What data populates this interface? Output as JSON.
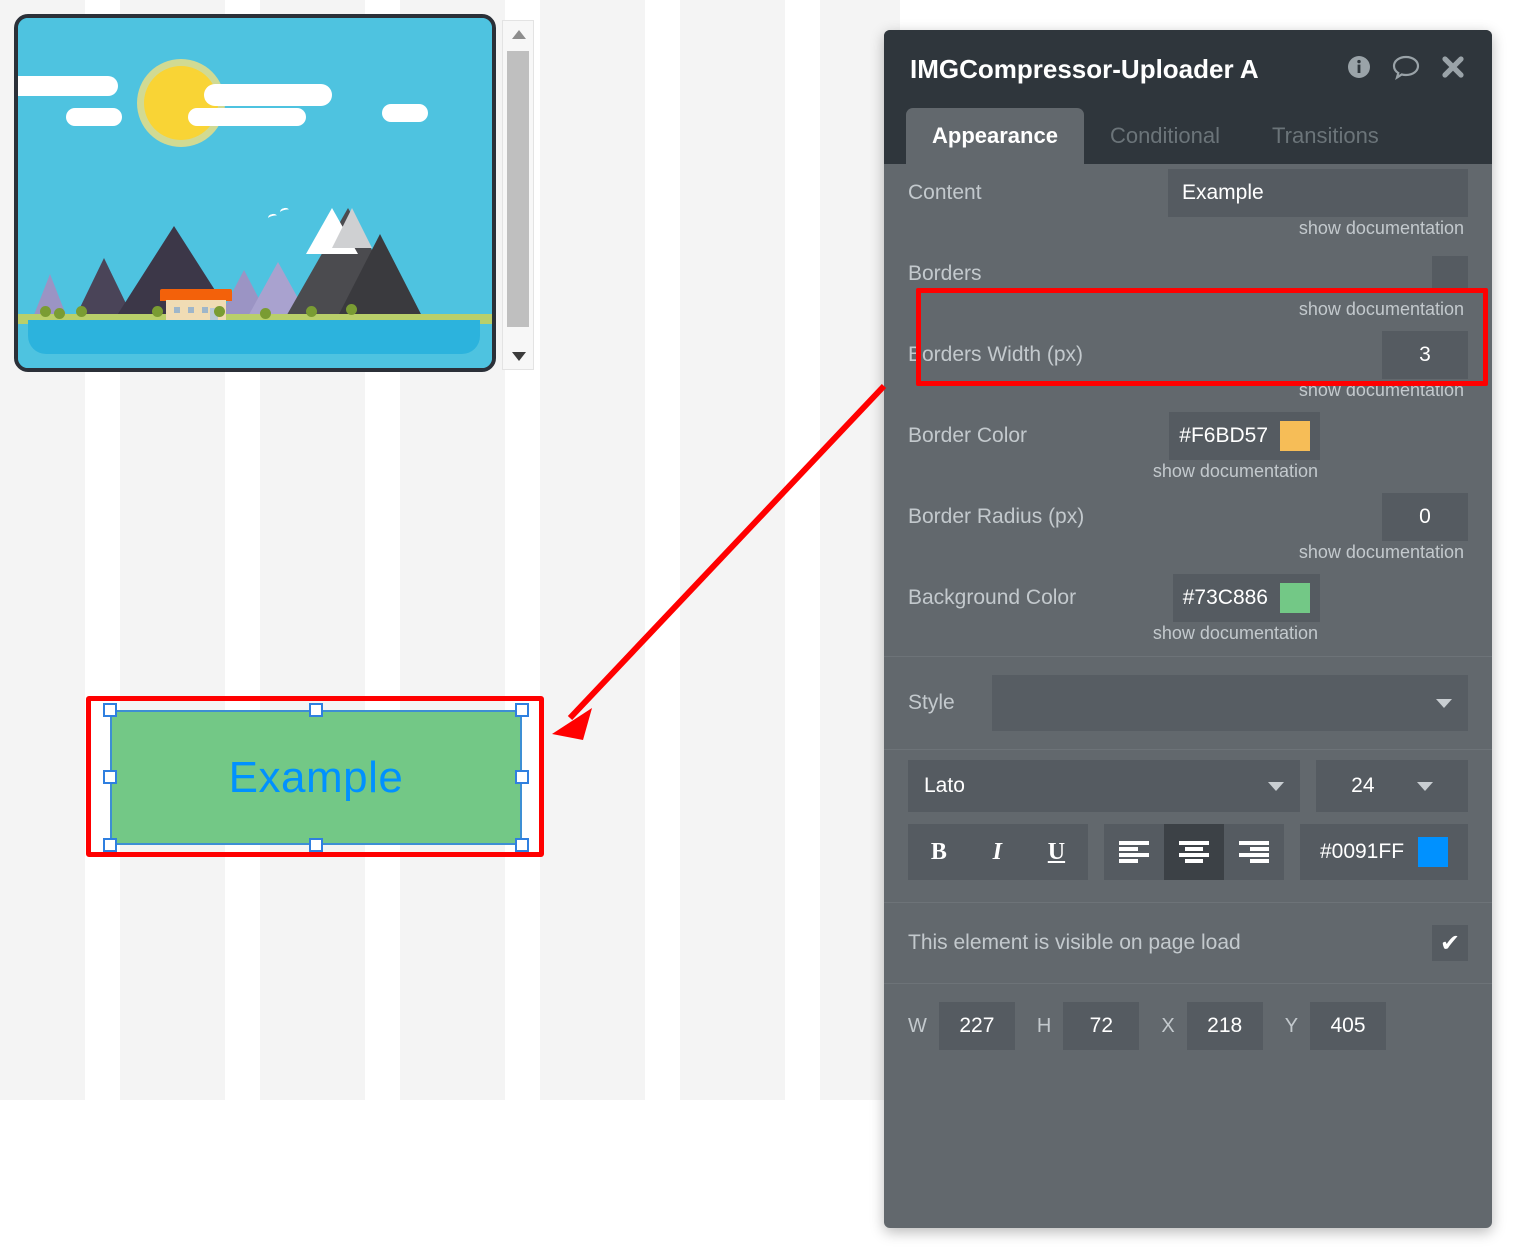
{
  "canvas": {
    "image_widget": {
      "alt": "flat-design landscape illustration with sun, clouds, mountains, house and lake",
      "scrollbar": {
        "up_icon": "triangle-up-icon",
        "down_icon": "triangle-down-icon"
      }
    },
    "selected_element": {
      "text": "Example",
      "background_color": "#73C886",
      "text_color": "#0091FF"
    }
  },
  "panel": {
    "title": "IMGCompressor-Uploader A",
    "title_icons": [
      {
        "name": "info-icon",
        "glyph": "ⓘ"
      },
      {
        "name": "comment-icon",
        "glyph": "◯"
      },
      {
        "name": "close-icon",
        "glyph": "✖"
      }
    ],
    "tabs": [
      {
        "label": "Appearance",
        "active": true
      },
      {
        "label": "Conditional",
        "active": false
      },
      {
        "label": "Transitions",
        "active": false
      }
    ],
    "doc_link": "show documentation",
    "properties": [
      {
        "label": "Content",
        "value": "Example"
      },
      {
        "label": "Borders",
        "value": ""
      },
      {
        "label": "Borders Width (px)",
        "value": "3"
      },
      {
        "label": "Border Color",
        "value": "#F6BD57"
      },
      {
        "label": "Border Radius (px)",
        "value": "0"
      },
      {
        "label": "Background Color",
        "value": "#73C886"
      }
    ],
    "style": {
      "label": "Style",
      "value": ""
    },
    "font": {
      "family": "Lato",
      "size": "24",
      "color": "#0091FF"
    },
    "format": {
      "bold": "B",
      "italic": "I",
      "underline": "U",
      "align_left": "align-left",
      "align_center": "align-center",
      "align_right": "align-right",
      "active_align": "align-center"
    },
    "visibility": {
      "label": "This element is visible on page load",
      "checked": true,
      "check_glyph": "✔"
    },
    "geometry": [
      {
        "key": "W",
        "value": "227"
      },
      {
        "key": "H",
        "value": "72"
      },
      {
        "key": "X",
        "value": "218"
      },
      {
        "key": "Y",
        "value": "405"
      }
    ]
  },
  "annotation": {
    "color": "#FF0000"
  }
}
